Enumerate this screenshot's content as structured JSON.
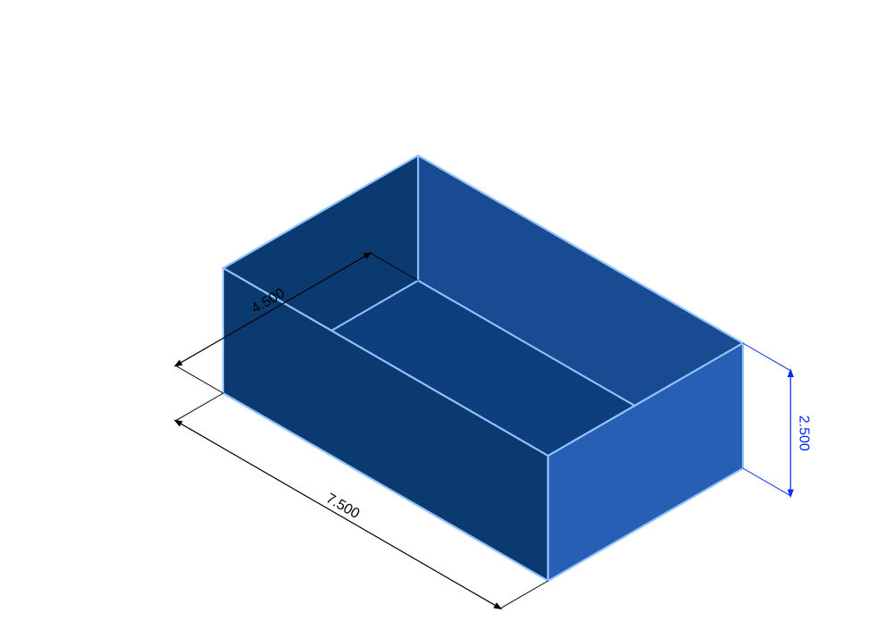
{
  "box": {
    "length": 7.5,
    "width": 4.5,
    "height": 2.5,
    "colors": {
      "top": "#2d6fd0",
      "right": "#265fb3",
      "front": "#0b3a70",
      "edge": "#8fc2ff",
      "insideA": "#184b91",
      "insideB": "#0e3e7d"
    }
  },
  "dimensions": {
    "length_label": "7.500",
    "width_label": "4.500",
    "height_label": "2.500",
    "colors": {
      "len": "#000000",
      "wid": "#000000",
      "hgt": "#0028ff"
    }
  }
}
